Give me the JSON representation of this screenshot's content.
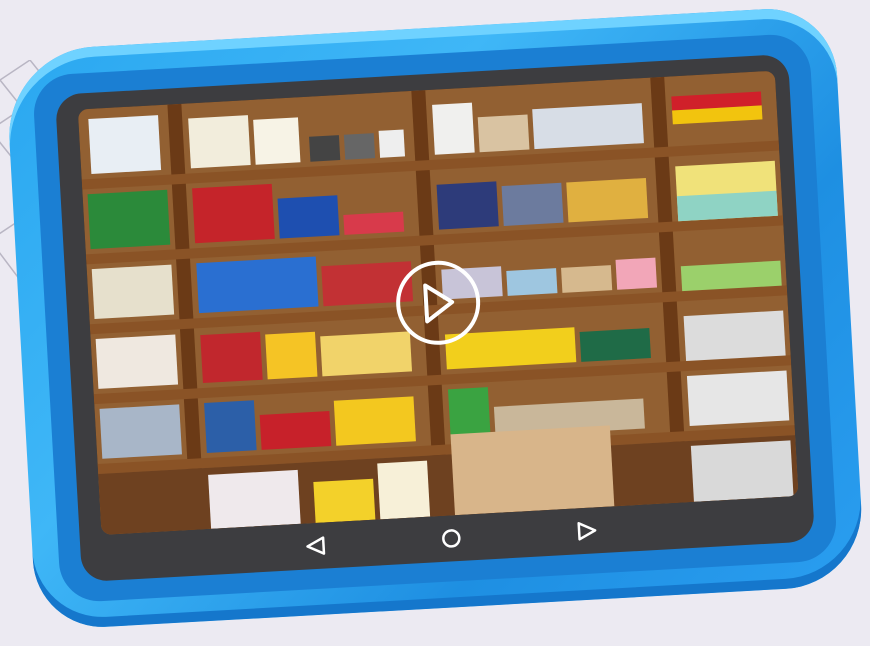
{
  "colors": {
    "background": "#eceaf2",
    "bumper": "#2aa7f0",
    "bezel": "#3d3d40",
    "shelf_wood": "#8a5326",
    "nav_icon": "#ffffff"
  },
  "screen": {
    "content": "stationery-store-shelves-photo",
    "overlay_icon": "play-icon"
  },
  "navbar": {
    "back_icon": "back-triangle-icon",
    "home_icon": "home-circle-icon",
    "recents_icon": "forward-triangle-icon"
  }
}
